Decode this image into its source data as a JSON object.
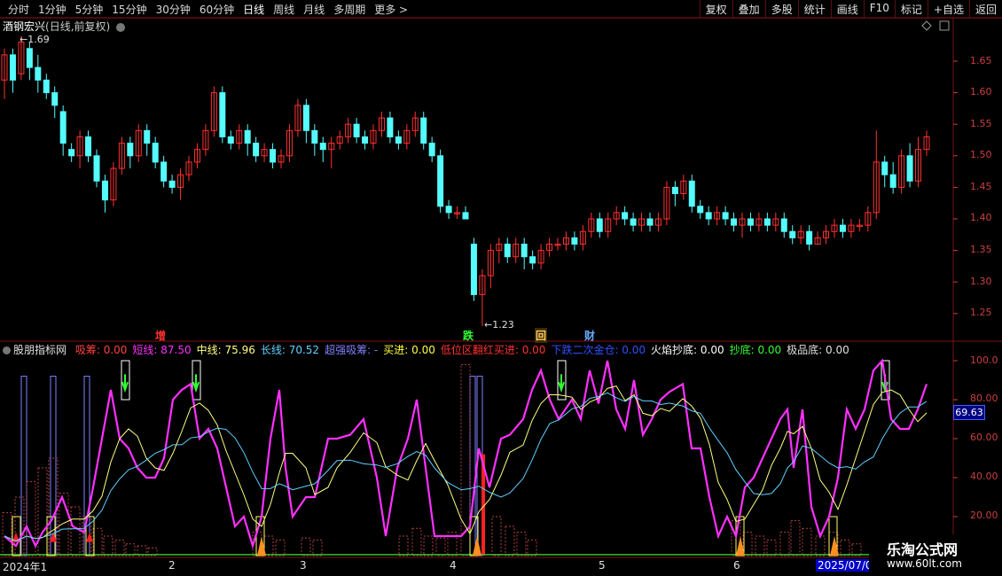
{
  "toolbar": {
    "periods": [
      "分时",
      "1分钟",
      "5分钟",
      "15分钟",
      "30分钟",
      "60分钟",
      "日线",
      "周线",
      "月线",
      "多周期",
      "更多 >"
    ],
    "active_period": "日线",
    "buttons": [
      "复权",
      "叠加",
      "多股",
      "统计",
      "画线",
      "F10",
      "标记",
      "+自选",
      "返回"
    ]
  },
  "stock": {
    "name": "酒钢宏兴",
    "mode": "(日线,前复权)",
    "high_label": "1.69",
    "low_label": "1.23"
  },
  "price_axis": [
    "1.65",
    "1.60",
    "1.55",
    "1.50",
    "1.45",
    "1.40",
    "1.35",
    "1.30",
    "1.25"
  ],
  "event_marks": [
    {
      "text": "增",
      "color": "#ff3030"
    },
    {
      "text": "跌",
      "color": "#30ff30"
    },
    {
      "text": "回",
      "color": "#ffcc66"
    },
    {
      "text": "财",
      "color": "#66aaff"
    }
  ],
  "indicator": {
    "name": "股朋指标网",
    "items": [
      {
        "label": "吸筹: 0.00",
        "color": "#ff4040"
      },
      {
        "label": "短线: 87.50",
        "color": "#ff30ff"
      },
      {
        "label": "中线: 75.96",
        "color": "#ffff80"
      },
      {
        "label": "长线: 70.52",
        "color": "#60d0ff"
      },
      {
        "label": "超强吸筹: -",
        "color": "#8080ff"
      },
      {
        "label": "买进: 0.00",
        "color": "#ffff40"
      },
      {
        "label": "低位区翻红买进: 0.00",
        "color": "#ff3030"
      },
      {
        "label": "下跌二次金仓: 0.00",
        "color": "#3050ff"
      },
      {
        "label": "火焰抄底: 0.00",
        "color": "#ffffff"
      },
      {
        "label": "抄底: 0.00",
        "color": "#30ff30"
      },
      {
        "label": "极品底: 0.00",
        "color": "#e0e0e0"
      }
    ],
    "axis": [
      "100.0",
      "80.00",
      "60.00",
      "40.00",
      "20.00"
    ],
    "current_value": "69.63"
  },
  "date_axis": [
    "2024年1",
    "2",
    "3",
    "4",
    "5",
    "6",
    "2025/07/0"
  ],
  "watermark": {
    "title": "乐淘公式网",
    "url": "www.60lt.com"
  },
  "colors": {
    "up": "#ff3030",
    "down": "#54fcfc",
    "grid": "#7a1414"
  }
}
